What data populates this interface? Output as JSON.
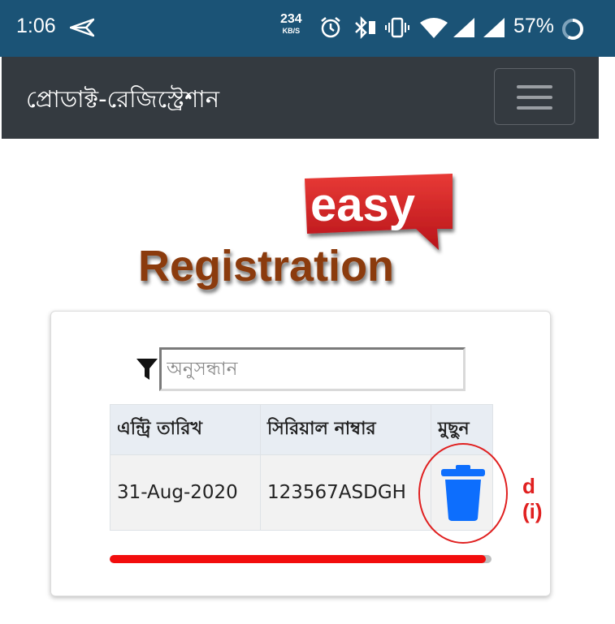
{
  "status_bar": {
    "time": "1:06",
    "net_speed_value": "234",
    "net_speed_unit": "KB/S",
    "battery": "57%",
    "icons": [
      "send-icon",
      "alarm-icon",
      "bluetooth-icon",
      "vibrate-icon",
      "wifi-icon",
      "signal-icon",
      "signal-icon",
      "battery-ring-icon"
    ]
  },
  "navbar": {
    "brand": "প্রোডাক্ট-রেজিস্ট্রেশান",
    "toggler_icon": "hamburger-menu-icon",
    "background": "#343a40"
  },
  "logo": {
    "top_word": "easy",
    "bottom_word": "Registration"
  },
  "search": {
    "placeholder": "অনুসন্ধান",
    "value": "",
    "icon": "filter-icon"
  },
  "table": {
    "headers": [
      "এন্ট্রি তারিখ",
      "সিরিয়াল নাম্বার",
      "মুছুন"
    ],
    "rows": [
      {
        "date": "31-Aug-2020",
        "serial": "123567ASDGH",
        "action_icon": "trash-icon"
      }
    ]
  },
  "annotation": {
    "label": "d (i)",
    "color": "#e02020"
  },
  "progress": {
    "fraction": 0.985,
    "fill_color": "#f20d0d",
    "track_color": "#bdbdbd"
  },
  "colors": {
    "status_bar": "#1b5376",
    "trash": "#0d6efd"
  }
}
